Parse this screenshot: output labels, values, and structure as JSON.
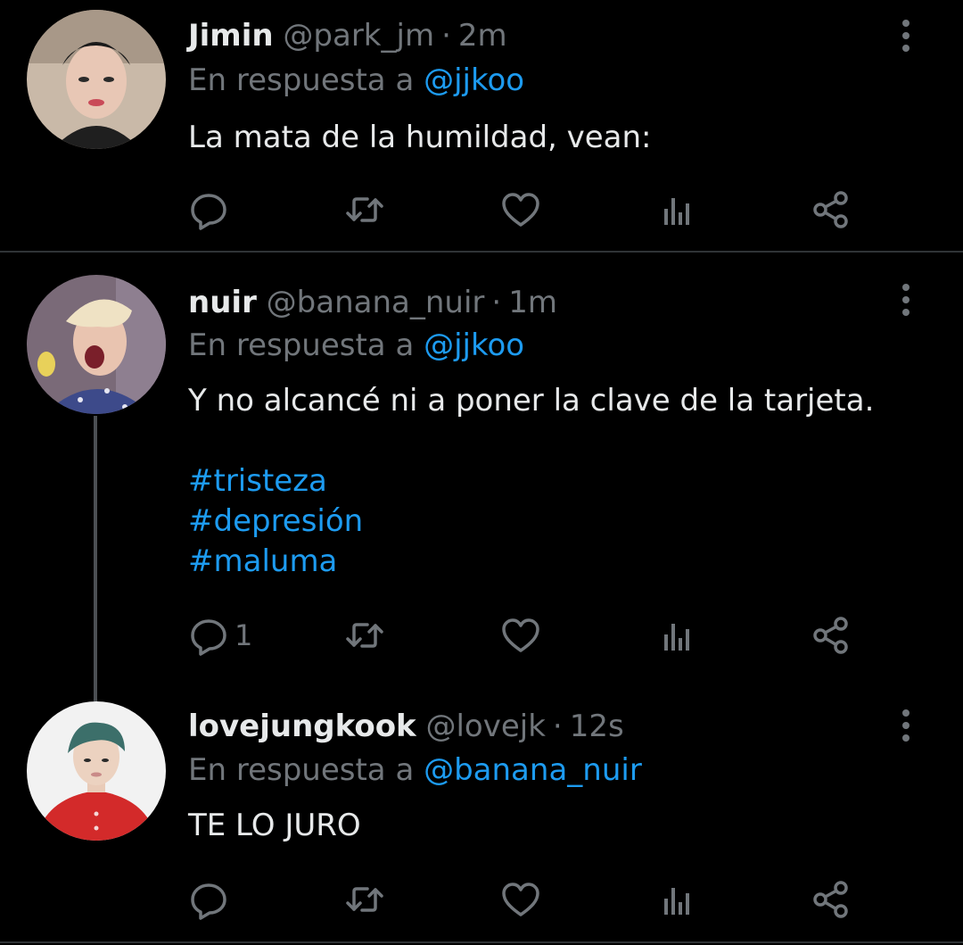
{
  "colors": {
    "background": "#000000",
    "text": "#e7e9ea",
    "muted": "#71767b",
    "link": "#1d9bf0",
    "divider": "#2f3336"
  },
  "tweets": [
    {
      "name": "Jimin",
      "handle": "@park_jm",
      "separator": "·",
      "time": "2m",
      "reply_prefix": "En respuesta a",
      "reply_to": "@jjkoo",
      "text": "La mata de la humildad, vean:",
      "hashtags": [],
      "reply_count": "",
      "icons": [
        "reply-icon",
        "retweet-icon",
        "like-icon",
        "analytics-icon",
        "share-icon",
        "more-icon"
      ]
    },
    {
      "name": "nuir",
      "handle": "@banana_nuir",
      "separator": "·",
      "time": "1m",
      "reply_prefix": "En respuesta a",
      "reply_to": "@jjkoo",
      "text": "Y no alcancé ni a poner la clave de la tarjeta.",
      "hashtags": [
        "#tristeza",
        "#depresión",
        "#maluma"
      ],
      "reply_count": "1",
      "icons": [
        "reply-icon",
        "retweet-icon",
        "like-icon",
        "analytics-icon",
        "share-icon",
        "more-icon"
      ]
    },
    {
      "name": "lovejungkook",
      "handle": "@lovejk",
      "separator": "·",
      "time": "12s",
      "reply_prefix": "En respuesta a",
      "reply_to": "@banana_nuir",
      "text": "TE LO JURO",
      "hashtags": [],
      "reply_count": "",
      "icons": [
        "reply-icon",
        "retweet-icon",
        "like-icon",
        "analytics-icon",
        "share-icon",
        "more-icon"
      ]
    }
  ]
}
